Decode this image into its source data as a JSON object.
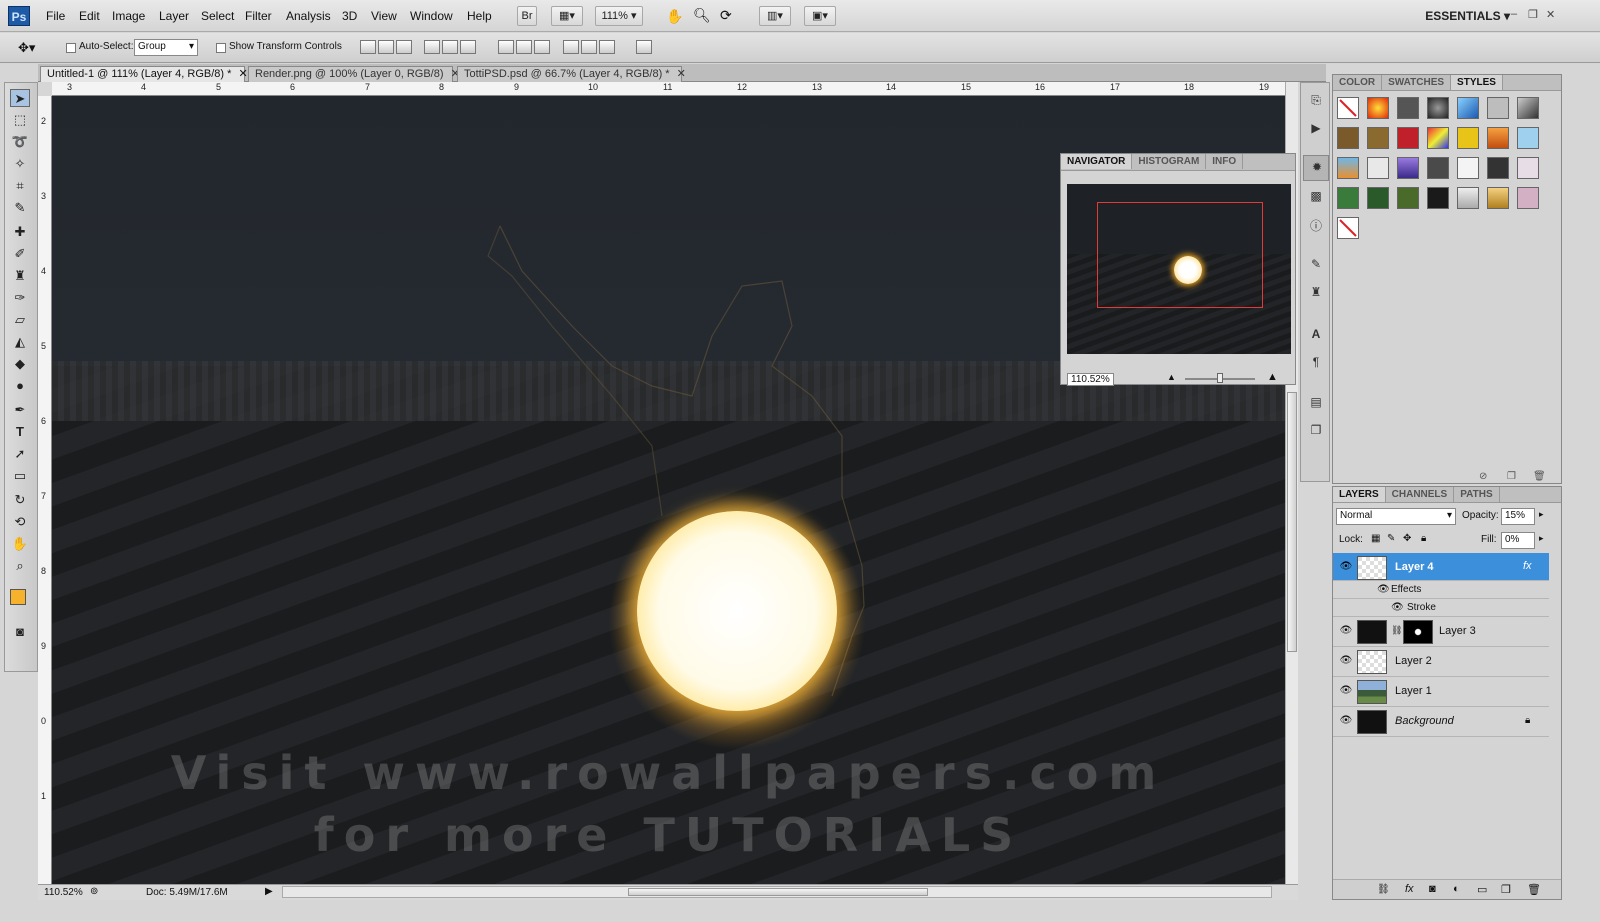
{
  "app": {
    "logo": "Ps"
  },
  "menu": [
    "File",
    "Edit",
    "Image",
    "Layer",
    "Select",
    "Filter",
    "Analysis",
    "3D",
    "View",
    "Window",
    "Help"
  ],
  "menubar": {
    "br_label": "Br",
    "zoom_value": "111%",
    "workspace": "ESSENTIALS"
  },
  "options": {
    "auto_select_label": "Auto-Select:",
    "auto_select_value": "Group",
    "transform_label": "Show Transform Controls"
  },
  "tabs": [
    {
      "label": "Untitled-1 @ 111% (Layer 4, RGB/8) *"
    },
    {
      "label": "Render.png @ 100% (Layer 0, RGB/8)"
    },
    {
      "label": "TottiPSD.psd @ 66.7% (Layer 4, RGB/8) *"
    }
  ],
  "ruler_top": [
    "3",
    "4",
    "5",
    "6",
    "7",
    "8",
    "9",
    "10",
    "11",
    "12",
    "13",
    "14",
    "15",
    "16",
    "17",
    "18",
    "19"
  ],
  "ruler_left": [
    "2",
    "3",
    "4",
    "5",
    "6",
    "7",
    "8",
    "9",
    "0",
    "1"
  ],
  "canvas": {
    "watermark_line1": "Visit www.rowallpapers.com",
    "watermark_line2": "for more TUTORIALS"
  },
  "status": {
    "zoom": "110.52%",
    "doc": "Doc: 5.49M/17.6M"
  },
  "navigator": {
    "tabs": [
      "NAVIGATOR",
      "HISTOGRAM",
      "INFO"
    ],
    "zoom": "110.52%"
  },
  "styles_panel": {
    "tabs": [
      "COLOR",
      "SWATCHES",
      "STYLES"
    ]
  },
  "layers_panel": {
    "tabs": [
      "LAYERS",
      "CHANNELS",
      "PATHS"
    ],
    "blend_mode": "Normal",
    "opacity_label": "Opacity:",
    "opacity": "15%",
    "lock_label": "Lock:",
    "fill_label": "Fill:",
    "fill": "0%",
    "layers": [
      {
        "name": "Layer 4",
        "selected": true
      },
      {
        "name": "Effects"
      },
      {
        "name": "Stroke"
      },
      {
        "name": "Layer 3"
      },
      {
        "name": "Layer 2"
      },
      {
        "name": "Layer 1"
      },
      {
        "name": "Background"
      }
    ]
  },
  "colors": {
    "accent": "#3c8fdb",
    "foreground": "#f6b12d",
    "nav_box": "#e03a3a"
  }
}
